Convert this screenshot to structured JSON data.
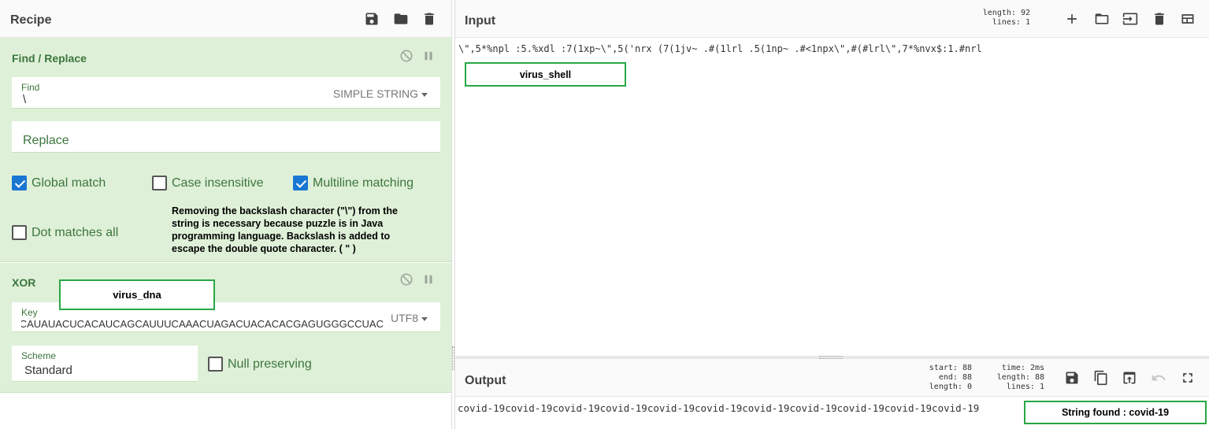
{
  "recipe": {
    "title": "Recipe",
    "header_icons": [
      "save-icon",
      "folder-icon",
      "trash-icon"
    ],
    "find_replace": {
      "title": "Find / Replace",
      "find_label": "Find",
      "find_value": "\\",
      "find_type": "SIMPLE STRING",
      "replace_placeholder": "Replace",
      "global_match": {
        "label": "Global match",
        "checked": true
      },
      "case_insensitive": {
        "label": "Case insensitive",
        "checked": false
      },
      "multiline": {
        "label": "Multiline matching",
        "checked": true
      },
      "dot_matches_all": {
        "label": "Dot matches all",
        "checked": false
      }
    },
    "note": "Removing the backslash character (\"\\\") from the string is necessary because puzzle is in Java programming language. Backslash is added to escape the double quote character. ( \" )",
    "xor": {
      "title": "XOR",
      "key_label": "Key",
      "key_value": "GCAUAUACUCACAUCAGCAUUUCAAACUAGACUACACACGAGUGGGCCUAC",
      "key_encoding": "UTF8",
      "scheme_label": "Scheme",
      "scheme_value": "Standard",
      "null_preserving": {
        "label": "Null preserving",
        "checked": false
      }
    },
    "annotation_virus_dna": "virus_dna"
  },
  "input": {
    "title": "Input",
    "length_label": "length:",
    "length": "92",
    "lines_label": "lines:",
    "lines": "1",
    "text": "\\\",5*%npl :5.%xdl :7(1xp~\\\",5('nrx (7(1jv~ .#(1lrl .5(1np~ .#<1npx\\\",#(#lrl\\\",7*%nvx$:1.#nrl",
    "annotation": "virus_shell",
    "header_icons": [
      "plus-icon",
      "open-folder-icon",
      "import-icon",
      "trash-icon",
      "layout-icon"
    ]
  },
  "output": {
    "title": "Output",
    "start_label": "start:",
    "start": "88",
    "end_label": "end:",
    "end": "88",
    "length_label": "length:",
    "length": "0",
    "time_label": "time:",
    "time": "2ms",
    "olength_label": "length:",
    "olength": "88",
    "lines_label": "lines:",
    "lines": "1",
    "text": "covid-19covid-19covid-19covid-19covid-19covid-19covid-19covid-19covid-19covid-19covid-19",
    "annotation": "String found : covid-19",
    "header_icons": [
      "save-icon",
      "copy-icon",
      "replace-input-icon",
      "undo-icon",
      "maximize-icon"
    ]
  }
}
